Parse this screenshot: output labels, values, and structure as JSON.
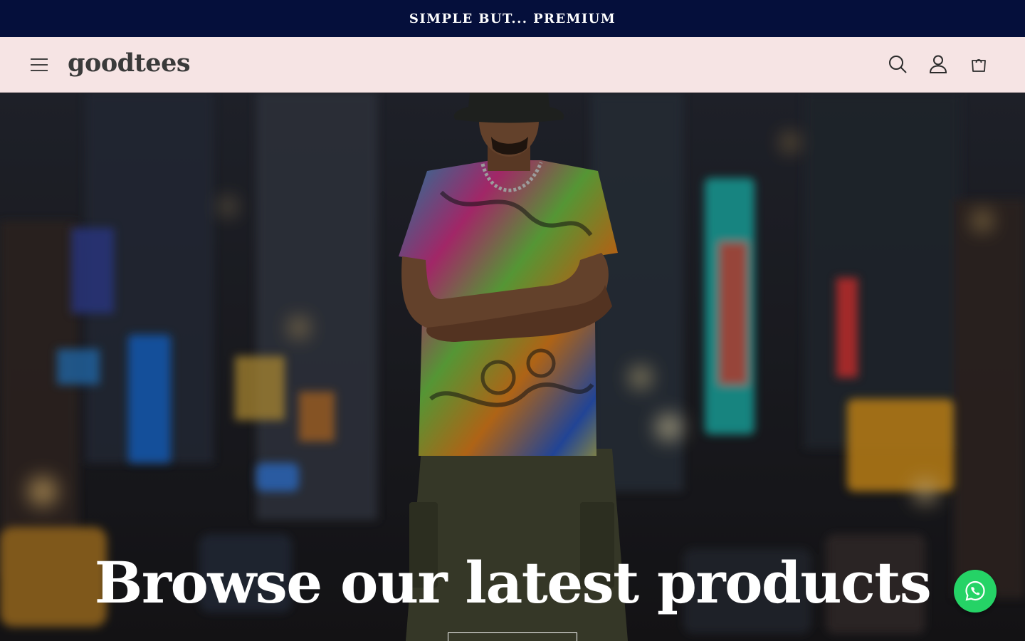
{
  "announcement": {
    "text": "SIMPLE BUT... PREMIUM"
  },
  "header": {
    "logo": "goodtees",
    "icons": {
      "menu": "hamburger-menu-icon",
      "search": "search-icon",
      "account": "account-icon",
      "cart": "cart-icon"
    }
  },
  "hero": {
    "heading": "Browse our latest products",
    "image": "man-in-colorful-graffiti-tshirt-city-street-photo"
  },
  "floating": {
    "whatsapp_icon": "whatsapp-icon"
  },
  "colors": {
    "announcement_bg": "#050f3b",
    "header_bg": "#f6e4e4",
    "whatsapp": "#25d366",
    "text_light": "#ffffff",
    "logo_text": "#3a3a3a"
  }
}
